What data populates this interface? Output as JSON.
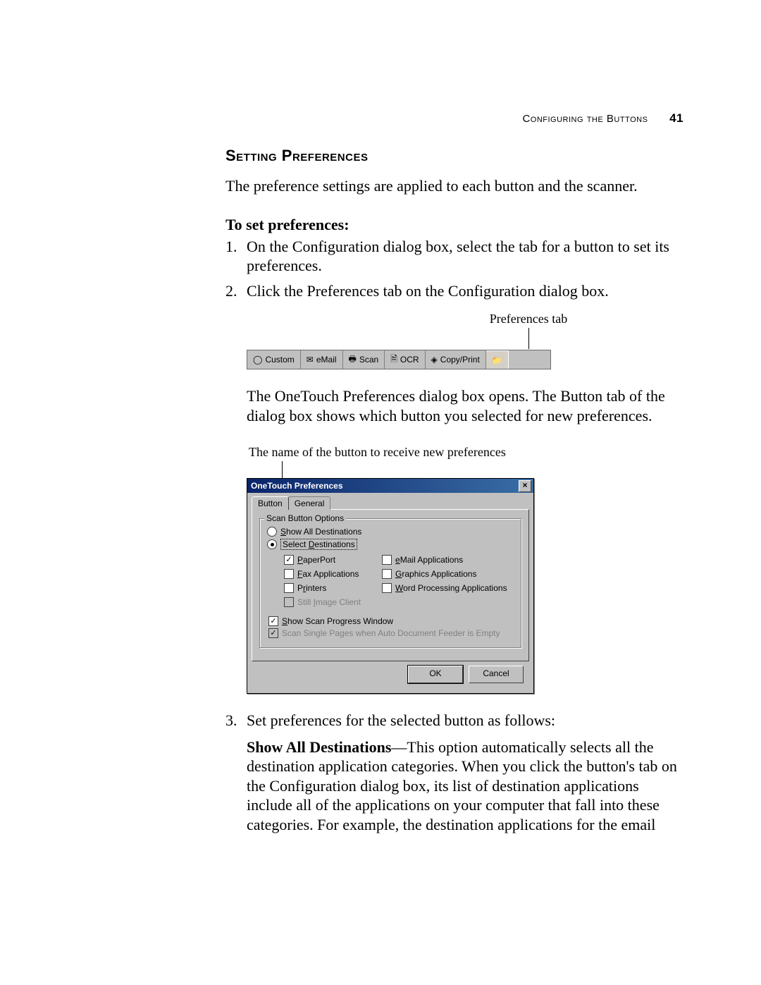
{
  "header": {
    "running_head": "Configuring the Buttons",
    "page_number": "41"
  },
  "section_title": "Setting Preferences",
  "intro_text": "The preference settings are applied to each button and the scanner.",
  "sub_heading": "To set preferences:",
  "steps": {
    "s1_num": "1.",
    "s1_text": "On the Configuration dialog box, select the tab for a button to set its preferences.",
    "s2_num": "2.",
    "s2_text": "Click the Preferences tab on the Configuration dialog box.",
    "s3_num": "3.",
    "s3_text": "Set preferences for the selected button as follows:"
  },
  "callout1_label": "Preferences tab",
  "tabstrip": {
    "custom": "Custom",
    "email": "eMail",
    "scan": "Scan",
    "ocr": "OCR",
    "copyprint": "Copy/Print"
  },
  "mid_paragraph": "The OneTouch Preferences dialog box opens. The Button tab of the dialog box shows which button you selected for new preferences.",
  "callout2_label": "The name of the button to receive new preferences",
  "dialog": {
    "title": "OneTouch Preferences",
    "tab_button": "Button",
    "tab_general": "General",
    "groupbox_title": "Scan Button Options",
    "radio_show_all": "Show All Destinations",
    "radio_select_dest": "Select Destinations",
    "chk_paperport": "PaperPort",
    "chk_fax": "Fax Applications",
    "chk_printers": "Printers",
    "chk_still": "Still Image Client",
    "chk_email": "eMail Applications",
    "chk_graphics": "Graphics Applications",
    "chk_word": "Word Processing Applications",
    "chk_show_progress": "Show Scan Progress Window",
    "chk_scan_single": "Scan Single Pages when Auto Document Feeder is Empty",
    "btn_ok": "OK",
    "btn_cancel": "Cancel"
  },
  "desc_block": {
    "bold_lead": "Show All Destinations",
    "rest": "—This option automatically selects all the destination application categories. When you click the button's tab on the Configuration dialog box, its list of destination applications include all of the applications on your computer that fall into these categories. For example, the destination applications for the email"
  }
}
